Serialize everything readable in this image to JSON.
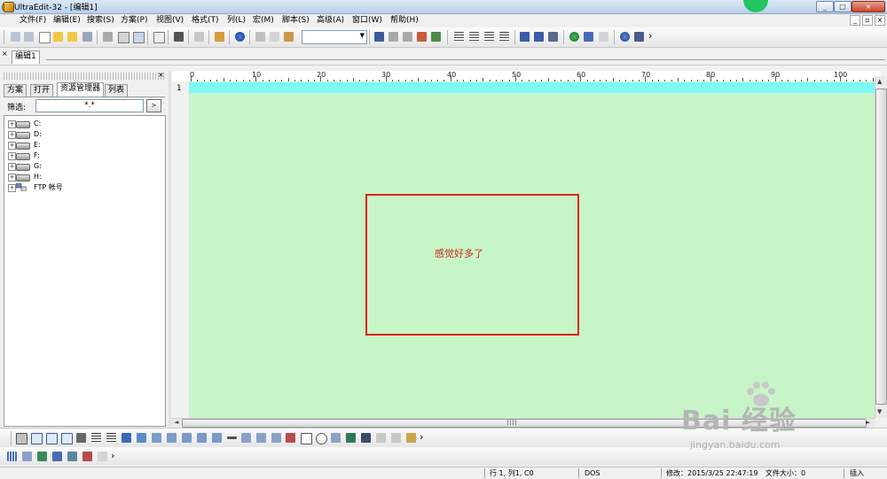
{
  "window": {
    "title": "UltraEdit-32 - [编辑1]",
    "controls": [
      "_",
      "□",
      "×"
    ]
  },
  "menu": {
    "items": [
      "文件(F)",
      "编辑(E)",
      "搜索(S)",
      "方案(P)",
      "视图(V)",
      "格式(T)",
      "列(L)",
      "宏(M)",
      "脚本(S)",
      "高级(A)",
      "窗口(W)",
      "帮助(H)"
    ],
    "mdi_controls": [
      "_",
      "▫",
      "×"
    ]
  },
  "toolbar": {
    "more": "›"
  },
  "doc_tabs": {
    "close": "×",
    "active": "编辑1"
  },
  "left_panel": {
    "close": "×",
    "tabs": [
      "方案",
      "打开",
      "资源管理器",
      "列表"
    ],
    "active_tab": "资源管理器",
    "filter_label": "筛选:",
    "filter_value": "*.*",
    "filter_button": ">",
    "tree": [
      {
        "label": "C:",
        "type": "drive"
      },
      {
        "label": "D:",
        "type": "drive"
      },
      {
        "label": "E:",
        "type": "drive"
      },
      {
        "label": "F:",
        "type": "drive"
      },
      {
        "label": "G:",
        "type": "drive"
      },
      {
        "label": "H:",
        "type": "drive"
      },
      {
        "label": "FTP 帐号",
        "type": "ftp"
      }
    ],
    "expander": "+"
  },
  "ruler": {
    "labels": [
      "0",
      "10",
      "20",
      "30",
      "40",
      "50",
      "60",
      "70",
      "80",
      "90",
      "100"
    ]
  },
  "editor": {
    "line_number": "1",
    "background": "#c7f5c7",
    "current_line_color": "#7ff7f7",
    "annotation_text": "感觉好多了",
    "annotation_color": "#e0241a"
  },
  "scrollbars": {
    "up": "▲",
    "down": "▼",
    "left": "◄",
    "right": "►"
  },
  "bottom_toolbars": {
    "more": "›"
  },
  "statusbar": {
    "position": "行 1, 列1, C0",
    "line_ending": "DOS",
    "modified": "修改：2015/3/25 22:47:19",
    "file_size": "文件大小：0",
    "mode": "插入"
  },
  "watermark": {
    "brand": "Bai 经验",
    "url": "jingyan.baidu.com"
  }
}
